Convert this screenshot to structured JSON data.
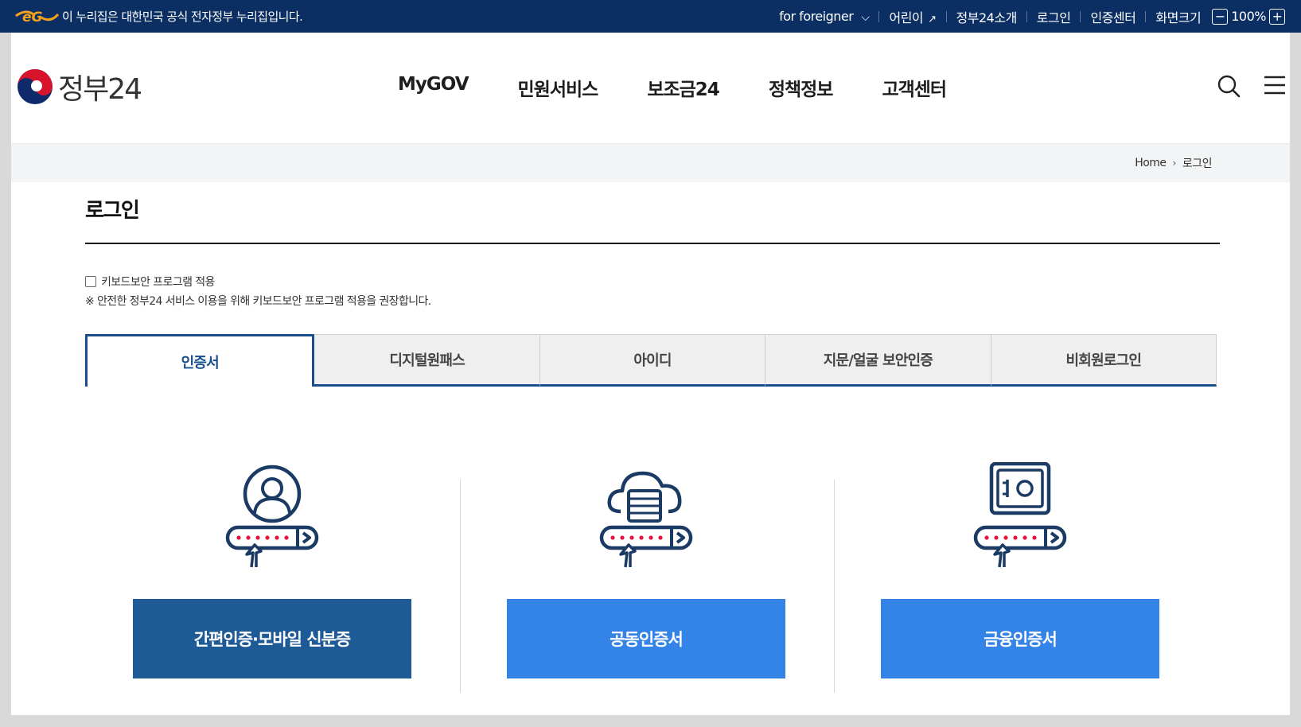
{
  "topbar": {
    "notice": "이 누리집은 대한민국 공식 전자정부 누리집입니다.",
    "links": {
      "foreigner": "for foreigner",
      "kids": "어린이",
      "about": "정부24소개",
      "login": "로그인",
      "cert_center": "인증센터",
      "font_size": "화면크기",
      "zoom": "100%"
    }
  },
  "header": {
    "logo_text": "정부24",
    "nav": [
      "MyGOV",
      "민원서비스",
      "보조금24",
      "정책정보",
      "고객센터"
    ]
  },
  "breadcrumb": {
    "home": "Home",
    "current": "로그인"
  },
  "page": {
    "title": "로그인",
    "keyboard_security_label": "키보드보안 프로그램 적용",
    "keyboard_security_checked": false,
    "notice": "※ 안전한 정부24 서비스 이용을 위해 키보드보안 프로그램 적용을 권장합니다."
  },
  "tabs": [
    {
      "label": "인증서",
      "active": true
    },
    {
      "label": "디지털원패스",
      "active": false
    },
    {
      "label": "아이디",
      "active": false
    },
    {
      "label": "지문/얼굴 보안인증",
      "active": false
    },
    {
      "label": "비회원로그인",
      "active": false
    }
  ],
  "login_options": [
    {
      "icon": "person-certificate-icon",
      "label": "간편인증·모바일 신분증",
      "color": "#1e5a96"
    },
    {
      "icon": "cloud-server-icon",
      "label": "공동인증서",
      "color": "#3384e6"
    },
    {
      "icon": "safe-icon",
      "label": "금융인증서",
      "color": "#3384e6"
    }
  ],
  "colors": {
    "gov_navy": "#0b2e63",
    "tab_accent": "#1a4f8f",
    "icon_navy": "#1b3a64",
    "dot_red": "#e5173f"
  }
}
